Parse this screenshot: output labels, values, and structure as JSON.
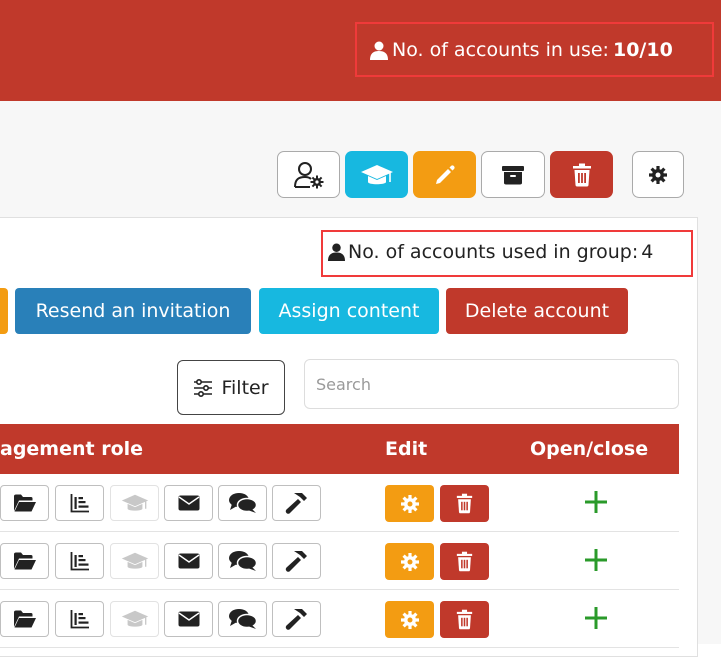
{
  "header": {
    "accounts_label": "No. of accounts in use:",
    "accounts_value": "10/10",
    "background": "#c0392b"
  },
  "toolbar": {
    "buttons": [
      {
        "name": "user-settings",
        "icon": "user-gear-icon"
      },
      {
        "name": "courses",
        "icon": "graduation-cap-icon",
        "color": "#17b8e0"
      },
      {
        "name": "edit",
        "icon": "pencil-icon",
        "color": "#f39c12"
      },
      {
        "name": "archive",
        "icon": "archive-box-icon"
      },
      {
        "name": "delete",
        "icon": "trash-icon",
        "color": "#c0392b"
      },
      {
        "name": "settings",
        "icon": "gear-icon"
      }
    ]
  },
  "group": {
    "label": "No. of accounts used in group:",
    "value": "4"
  },
  "actions": {
    "resend": "Resend an invitation",
    "assign": "Assign content",
    "delete": "Delete account"
  },
  "filter": {
    "label": "Filter",
    "search_placeholder": "Search"
  },
  "table": {
    "headers": {
      "management_role": "agement role",
      "edit": "Edit",
      "open_close": "Open/close"
    },
    "row_icons": [
      "folder-open-icon",
      "bar-chart-icon",
      "graduation-cap-icon",
      "envelope-icon",
      "comments-icon",
      "hammer-icon"
    ],
    "rows": 3
  },
  "colors": {
    "primary_red": "#c0392b",
    "blue": "#2980b9",
    "cyan": "#17b8e0",
    "orange": "#f39c12",
    "green": "#2a9a2a"
  }
}
